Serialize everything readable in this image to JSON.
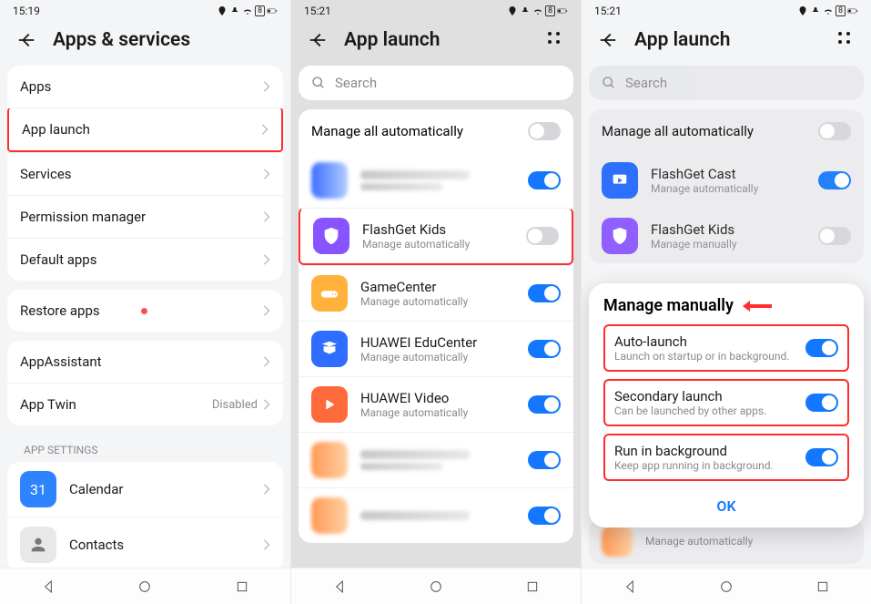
{
  "p1": {
    "time": "15:19",
    "title": "Apps & services",
    "items_group1": [
      "Apps",
      "App launch",
      "Services",
      "Permission manager",
      "Default apps"
    ],
    "restore": "Restore apps",
    "items_group3": [
      "AppAssistant"
    ],
    "app_twin": {
      "label": "App Twin",
      "status": "Disabled"
    },
    "section_label": "APP SETTINGS",
    "apps_list": [
      {
        "name": "Calendar",
        "icon_bg": "#2e83ff",
        "day": "31"
      },
      {
        "name": "Contacts",
        "icon_bg": "#e8e8eb"
      }
    ]
  },
  "p2": {
    "time": "15:21",
    "title": "App launch",
    "search_placeholder": "Search",
    "manage_all": "Manage all automatically",
    "apps": [
      {
        "name": "FlashGet Kids",
        "sub": "Manage automatically",
        "on": false,
        "bg": "#8754ff",
        "highlight": true
      },
      {
        "name": "GameCenter",
        "sub": "Manage automatically",
        "on": true,
        "bg": "#ffb13b"
      },
      {
        "name": "HUAWEI EduCenter",
        "sub": "Manage automatically",
        "on": true,
        "bg": "#2e6dff"
      },
      {
        "name": "HUAWEI Video",
        "sub": "Manage automatically",
        "on": true,
        "bg": "#ff6a3b"
      }
    ]
  },
  "p3": {
    "time": "15:21",
    "title": "App launch",
    "search_placeholder": "Search",
    "manage_all": "Manage all automatically",
    "bg_apps": [
      {
        "name": "FlashGet Cast",
        "sub": "Manage automatically",
        "on": true,
        "bg": "#1f64ff"
      },
      {
        "name": "FlashGet Kids",
        "sub": "Manage manually",
        "on": false,
        "bg": "#8754ff"
      }
    ],
    "sheet_title": "Manage manually",
    "sheet_items": [
      {
        "title": "Auto-launch",
        "sub": "Launch on startup or in background.",
        "on": true
      },
      {
        "title": "Secondary launch",
        "sub": "Can be launched by other apps.",
        "on": true
      },
      {
        "title": "Run in background",
        "sub": "Keep app running in background.",
        "on": true
      }
    ],
    "ok": "OK",
    "bottom_sub": "Manage automatically"
  }
}
